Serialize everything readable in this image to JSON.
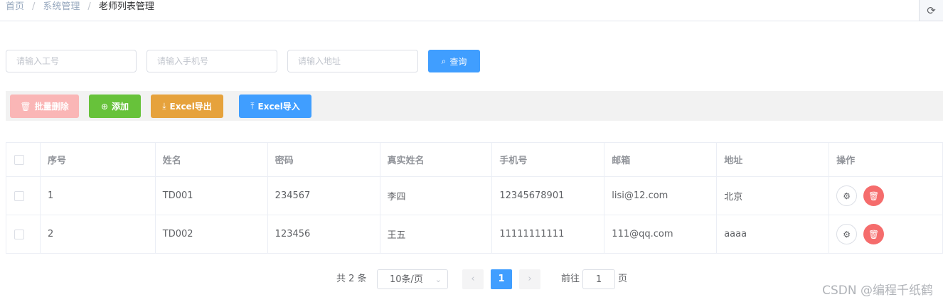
{
  "breadcrumb": {
    "home": "首页",
    "section": "系统管理",
    "current": "老师列表管理"
  },
  "search": {
    "job_placeholder": "请输入工号",
    "phone_placeholder": "请输入手机号",
    "address_placeholder": "请输入地址",
    "query_label": "查询"
  },
  "toolbar": {
    "batch_delete_label": "批量删除",
    "add_label": "添加",
    "export_label": "Excel导出",
    "import_label": "Excel导入"
  },
  "colors": {
    "primary": "#409eff",
    "success": "#67c23a",
    "warning": "#e6a23c",
    "danger": "#f56c6c",
    "danger_light": "#fab6b6"
  },
  "table": {
    "headers": [
      "序号",
      "姓名",
      "密码",
      "真实姓名",
      "手机号",
      "邮箱",
      "地址",
      "操作"
    ],
    "rows": [
      [
        "1",
        "TD001",
        "234567",
        "李四",
        "12345678901",
        "lisi@12.com",
        "北京"
      ],
      [
        "2",
        "TD002",
        "123456",
        "王五",
        "11111111111",
        "111@qq.com",
        "aaaa"
      ]
    ]
  },
  "pagination": {
    "total": "共 2 条",
    "page_size": "10条/页",
    "current_page": "1",
    "goto_label": "前往",
    "goto_value": "1",
    "page_suffix": "页"
  },
  "watermark": "CSDN @编程千纸鹤"
}
